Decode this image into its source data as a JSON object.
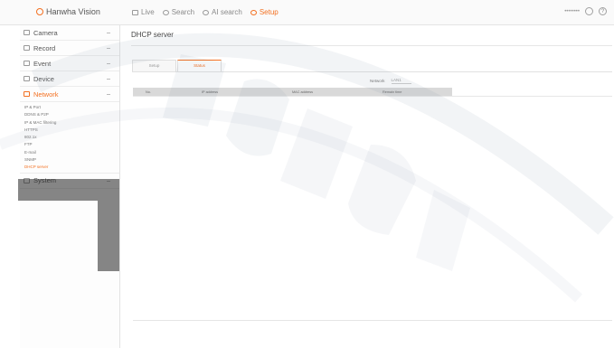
{
  "topbar": {
    "brand": "Hanwha Vision",
    "nav": [
      {
        "label": "Live",
        "active": false
      },
      {
        "label": "Search",
        "active": false
      },
      {
        "label": "AI search",
        "active": false
      },
      {
        "label": "Setup",
        "active": true
      }
    ],
    "user": "••••••••",
    "help_glyph": "?",
    "accent": "#f37021"
  },
  "sidebar": {
    "menus": [
      {
        "label": "Camera",
        "icon": "camera-icon"
      },
      {
        "label": "Record",
        "icon": "record-icon"
      },
      {
        "label": "Event",
        "icon": "event-icon"
      },
      {
        "label": "Device",
        "icon": "device-icon"
      },
      {
        "label": "Network",
        "icon": "network-icon",
        "active": true
      }
    ],
    "network_sub": [
      {
        "label": "IP & Port"
      },
      {
        "label": "DDNS & P2P"
      },
      {
        "label": "IP & MAC filtering"
      },
      {
        "label": "HTTPS"
      },
      {
        "label": "802.1x"
      },
      {
        "label": "FTP"
      },
      {
        "label": "E-mail"
      },
      {
        "label": "SNMP"
      },
      {
        "label": "DHCP server",
        "active": true
      }
    ],
    "system": {
      "label": "System",
      "icon": "system-icon"
    }
  },
  "main": {
    "title": "DHCP server",
    "tabs": [
      {
        "label": "Setup",
        "active": false
      },
      {
        "label": "Status",
        "active": true
      }
    ],
    "network_label": "Network",
    "network_value": "LAN1",
    "columns": [
      "No.",
      "IP address",
      "MAC address",
      "Remain time"
    ]
  }
}
